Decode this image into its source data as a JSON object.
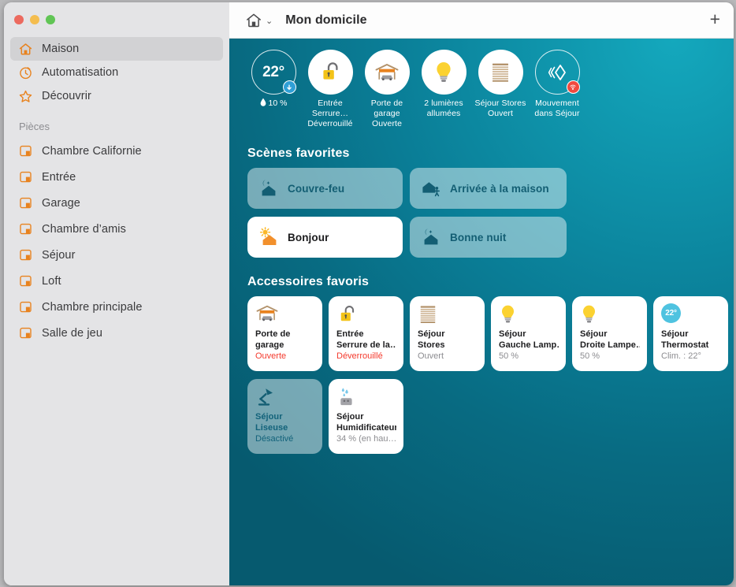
{
  "window": {
    "traffic_lights": [
      "close",
      "minimize",
      "zoom"
    ],
    "colors": {
      "close": "#ec6a5f",
      "minimize": "#f4bd4f",
      "zoom": "#61c555",
      "accent_orange": "#e8821e",
      "bg_teal_light": "#14a8bd",
      "bg_teal_dark": "#065a6f",
      "alert_red": "#f4392c",
      "scene_text": "#135e73"
    }
  },
  "toolbar": {
    "home_icon": "house-icon",
    "chevron": "⌄",
    "title": "Mon domicile",
    "add_label": "+"
  },
  "sidebar": {
    "items": [
      {
        "label": "Maison",
        "icon": "house-icon",
        "selected": true
      },
      {
        "label": "Automatisation",
        "icon": "clock-icon",
        "selected": false
      },
      {
        "label": "Découvrir",
        "icon": "star-icon",
        "selected": false
      }
    ],
    "rooms_section_title": "Pièces",
    "rooms": [
      {
        "label": "Chambre Californie",
        "icon": "room-icon"
      },
      {
        "label": "Entrée",
        "icon": "room-icon"
      },
      {
        "label": "Garage",
        "icon": "room-icon"
      },
      {
        "label": "Chambre d’amis",
        "icon": "room-icon"
      },
      {
        "label": "Séjour",
        "icon": "room-icon"
      },
      {
        "label": "Loft",
        "icon": "room-icon"
      },
      {
        "label": "Chambre principale",
        "icon": "room-icon"
      },
      {
        "label": "Salle de jeu",
        "icon": "room-icon"
      }
    ]
  },
  "status_strip": [
    {
      "type": "climate",
      "icon": "thermostat-ring",
      "value": "22°",
      "badge": "arrow-down-icon",
      "sub_icon": "humidity-drop-icon",
      "sub_value": "10 %",
      "caption_line1": "",
      "caption_line2": ""
    },
    {
      "type": "lock",
      "icon": "lock-open-icon",
      "caption_line1": "Entrée Serrure…",
      "caption_line2": "Déverrouillé"
    },
    {
      "type": "garage",
      "icon": "garage-door-icon",
      "caption_line1": "Porte de garage",
      "caption_line2": "Ouverte"
    },
    {
      "type": "lights",
      "icon": "lightbulb-icon",
      "caption_line1": "2 lumières",
      "caption_line2": "allumées"
    },
    {
      "type": "blinds",
      "icon": "blinds-icon",
      "caption_line1": "Séjour Stores",
      "caption_line2": "Ouvert"
    },
    {
      "type": "motion",
      "icon": "motion-sensor-icon",
      "badge": "motion-alert-icon",
      "caption_line1": "Mouvement",
      "caption_line2": "dans Séjour"
    }
  ],
  "scenes_section": {
    "title": "Scènes favorites",
    "scenes": [
      {
        "label": "Couvre-feu",
        "icon": "moon-house-icon",
        "active": false
      },
      {
        "label": "Arrivée à la maison",
        "icon": "house-person-icon",
        "active": false
      },
      {
        "label": "Bonjour",
        "icon": "sun-house-icon",
        "active": true
      },
      {
        "label": "Bonne nuit",
        "icon": "moon-house-icon",
        "active": false
      }
    ]
  },
  "accessories_section": {
    "title": "Accessoires favoris",
    "accessories": [
      {
        "icon": "garage-door-icon",
        "name_line1": "Porte de",
        "name_line2": "garage",
        "state": "Ouverte",
        "state_alert": true,
        "off": false
      },
      {
        "icon": "lock-open-icon",
        "name_line1": "Entrée",
        "name_line2": "Serrure de la…",
        "state": "Déverrouillé",
        "state_alert": true,
        "off": false
      },
      {
        "icon": "blinds-icon",
        "name_line1": "Séjour",
        "name_line2": "Stores",
        "state": "Ouvert",
        "state_alert": false,
        "off": false
      },
      {
        "icon": "lightbulb-icon",
        "name_line1": "Séjour",
        "name_line2": "Gauche Lamp…",
        "state": "50 %",
        "state_alert": false,
        "off": false
      },
      {
        "icon": "lightbulb-icon",
        "name_line1": "Séjour",
        "name_line2": "Droite Lampe…",
        "state": "50 %",
        "state_alert": false,
        "off": false
      },
      {
        "icon": "thermostat-pill-icon",
        "icon_value": "22°",
        "name_line1": "Séjour",
        "name_line2": "Thermostat",
        "state": "Clim. : 22°",
        "state_alert": false,
        "off": false
      },
      {
        "icon": "desk-lamp-icon",
        "name_line1": "Séjour",
        "name_line2": "Liseuse",
        "state": "Désactivé",
        "state_alert": false,
        "off": true
      },
      {
        "icon": "humidifier-icon",
        "name_line1": "Séjour",
        "name_line2": "Humidificateur",
        "state": "34 % (en hau…",
        "state_alert": false,
        "off": false
      }
    ]
  }
}
